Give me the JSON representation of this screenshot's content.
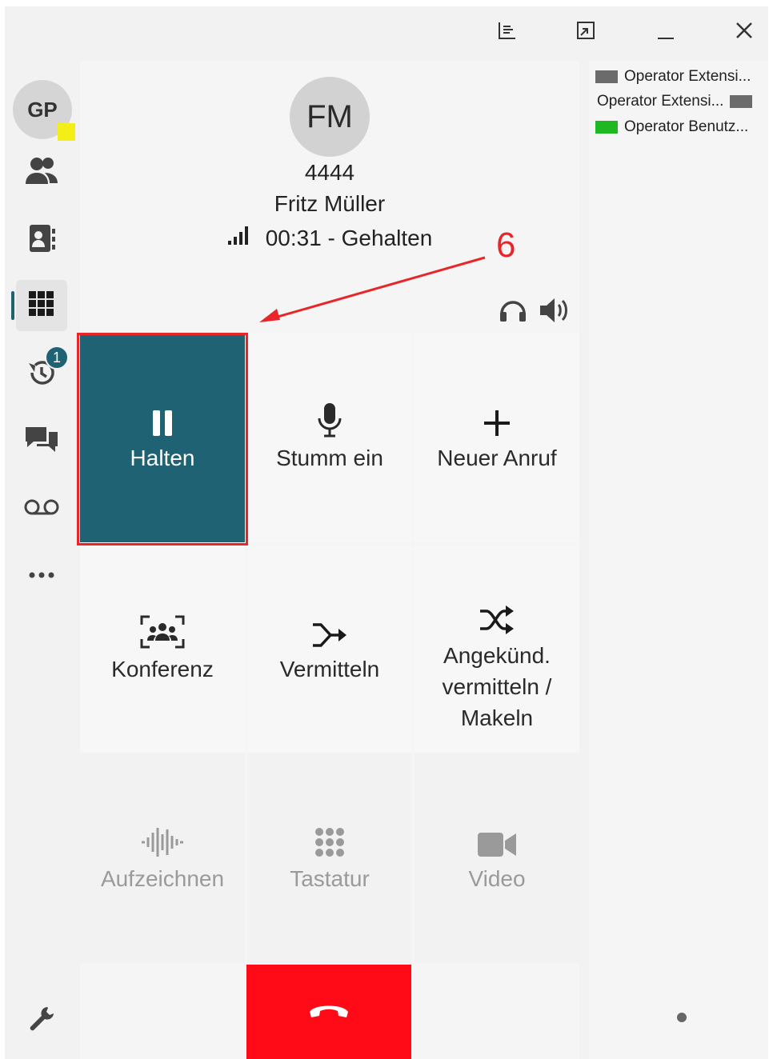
{
  "titlebar": {
    "icons": [
      "layout-icon",
      "restore-icon",
      "minimize-icon",
      "close-icon"
    ]
  },
  "sidebar": {
    "user_initials": "GP",
    "presence_color": "#f3ee17",
    "items": [
      {
        "name": "contacts",
        "icon": "people-icon"
      },
      {
        "name": "directory",
        "icon": "address-book-icon"
      },
      {
        "name": "dialpad",
        "icon": "dialpad-icon",
        "active": true
      },
      {
        "name": "history",
        "icon": "history-icon",
        "badge": "1"
      },
      {
        "name": "chat",
        "icon": "chat-icon"
      },
      {
        "name": "voicemail",
        "icon": "voicemail-icon"
      },
      {
        "name": "more",
        "icon": "more-icon"
      }
    ],
    "settings_icon": "wrench-icon",
    "accent_color": "#1f6273"
  },
  "call": {
    "initials": "FM",
    "number": "4444",
    "name": "Fritz Müller",
    "status": "00:31 - Gehalten",
    "buttons": {
      "hold": "Halten",
      "mute": "Stumm ein",
      "new_call": "Neuer Anruf",
      "conference": "Konferenz",
      "transfer": "Vermitteln",
      "attended_line1": "Angekünd.",
      "attended_line2": "vermitteln /",
      "attended_line3": "Makeln",
      "record": "Aufzeichnen",
      "keypad": "Tastatur",
      "video": "Video"
    },
    "hangup_color": "#ff0a16"
  },
  "operators": [
    {
      "label": "Operator Extensi...",
      "color": "#6b6b6b",
      "square_position": "left"
    },
    {
      "label": "Operator Extensi...",
      "color": "#6b6b6b",
      "square_position": "right"
    },
    {
      "label": "Operator Benutz...",
      "color": "#1fb823",
      "square_position": "left"
    }
  ],
  "annotation": {
    "number": "6",
    "color": "#e8262a"
  }
}
